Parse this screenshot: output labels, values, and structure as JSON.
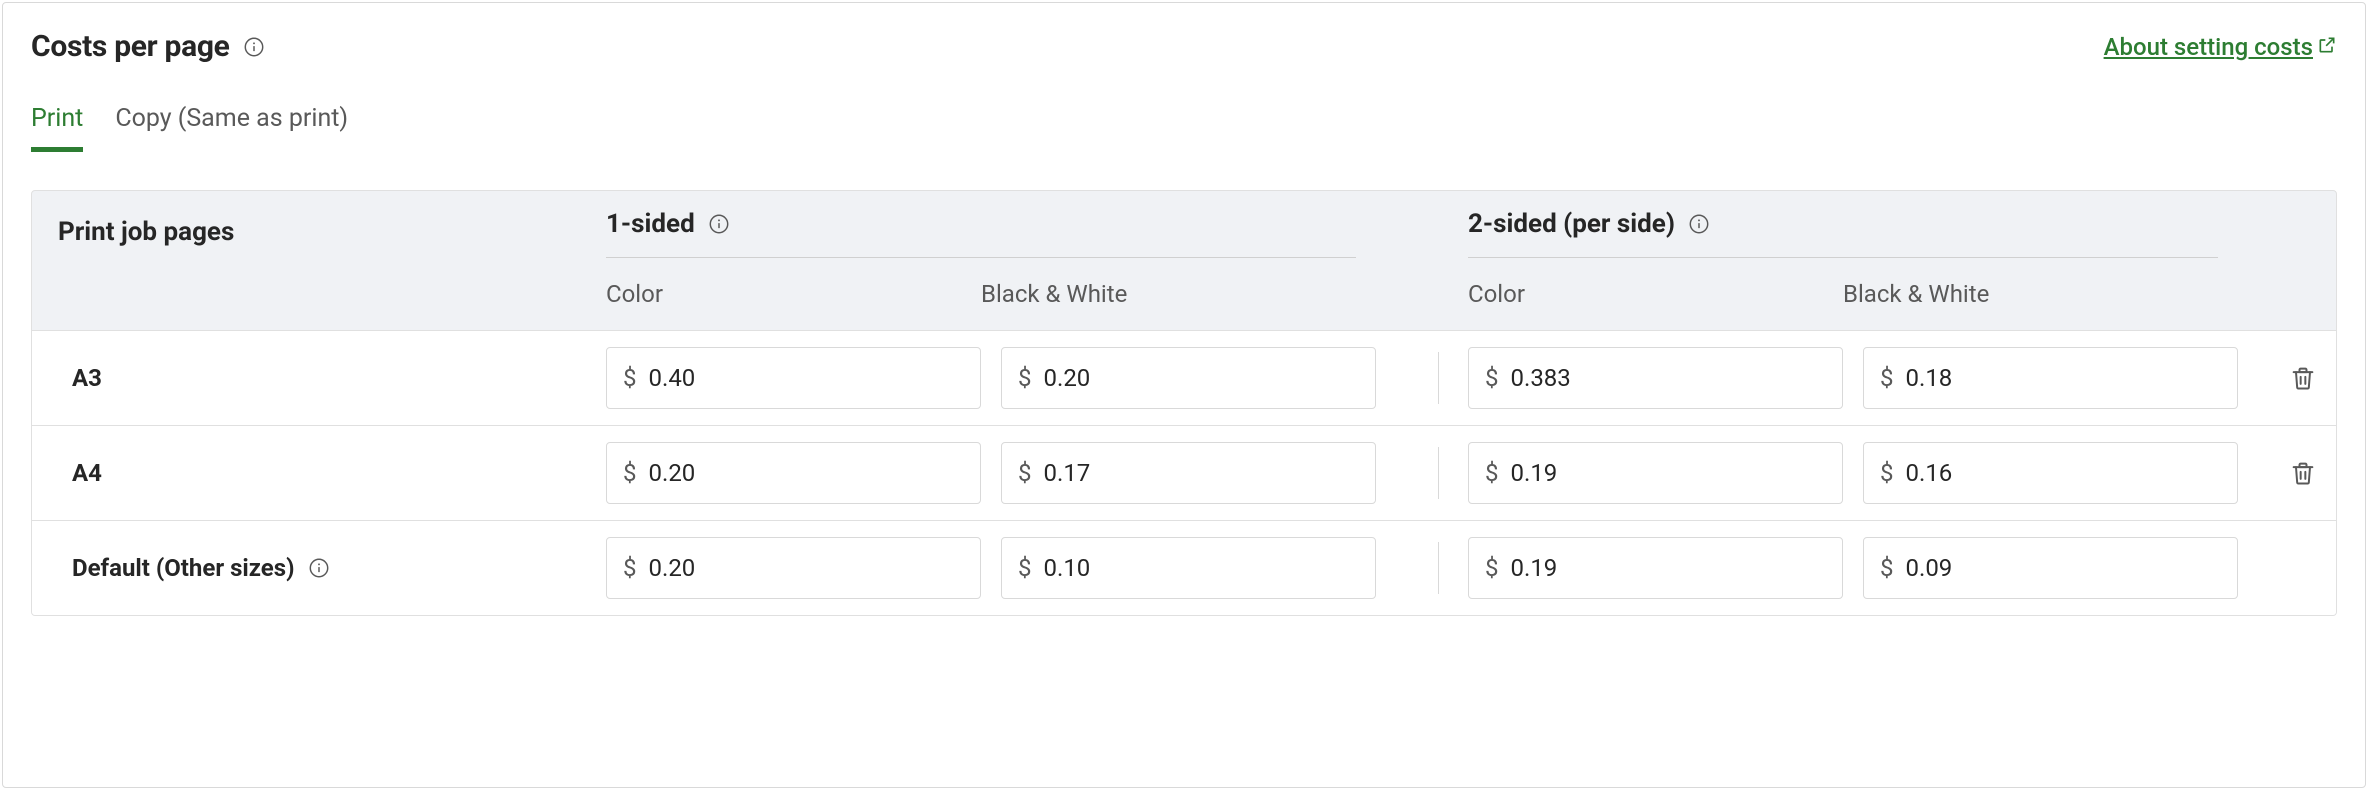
{
  "header": {
    "title": "Costs per page",
    "aboutLink": "About setting costs"
  },
  "tabs": [
    {
      "label": "Print",
      "active": true
    },
    {
      "label": "Copy (Same as print)",
      "active": false
    }
  ],
  "table": {
    "pagesHeader": "Print job pages",
    "groups": [
      {
        "label": "1-sided"
      },
      {
        "label": "2-sided (per side)"
      }
    ],
    "subHeaders": {
      "color": "Color",
      "bw": "Black & White"
    },
    "currency": "$",
    "rows": [
      {
        "label": "A3",
        "oneSided": {
          "color": "0.40",
          "bw": "0.20"
        },
        "twoSided": {
          "color": "0.383",
          "bw": "0.18"
        },
        "deletable": true
      },
      {
        "label": "A4",
        "oneSided": {
          "color": "0.20",
          "bw": "0.17"
        },
        "twoSided": {
          "color": "0.19",
          "bw": "0.16"
        },
        "deletable": true
      },
      {
        "label": "Default (Other sizes)",
        "hasInfo": true,
        "oneSided": {
          "color": "0.20",
          "bw": "0.10"
        },
        "twoSided": {
          "color": "0.19",
          "bw": "0.09"
        },
        "deletable": false
      }
    ]
  }
}
